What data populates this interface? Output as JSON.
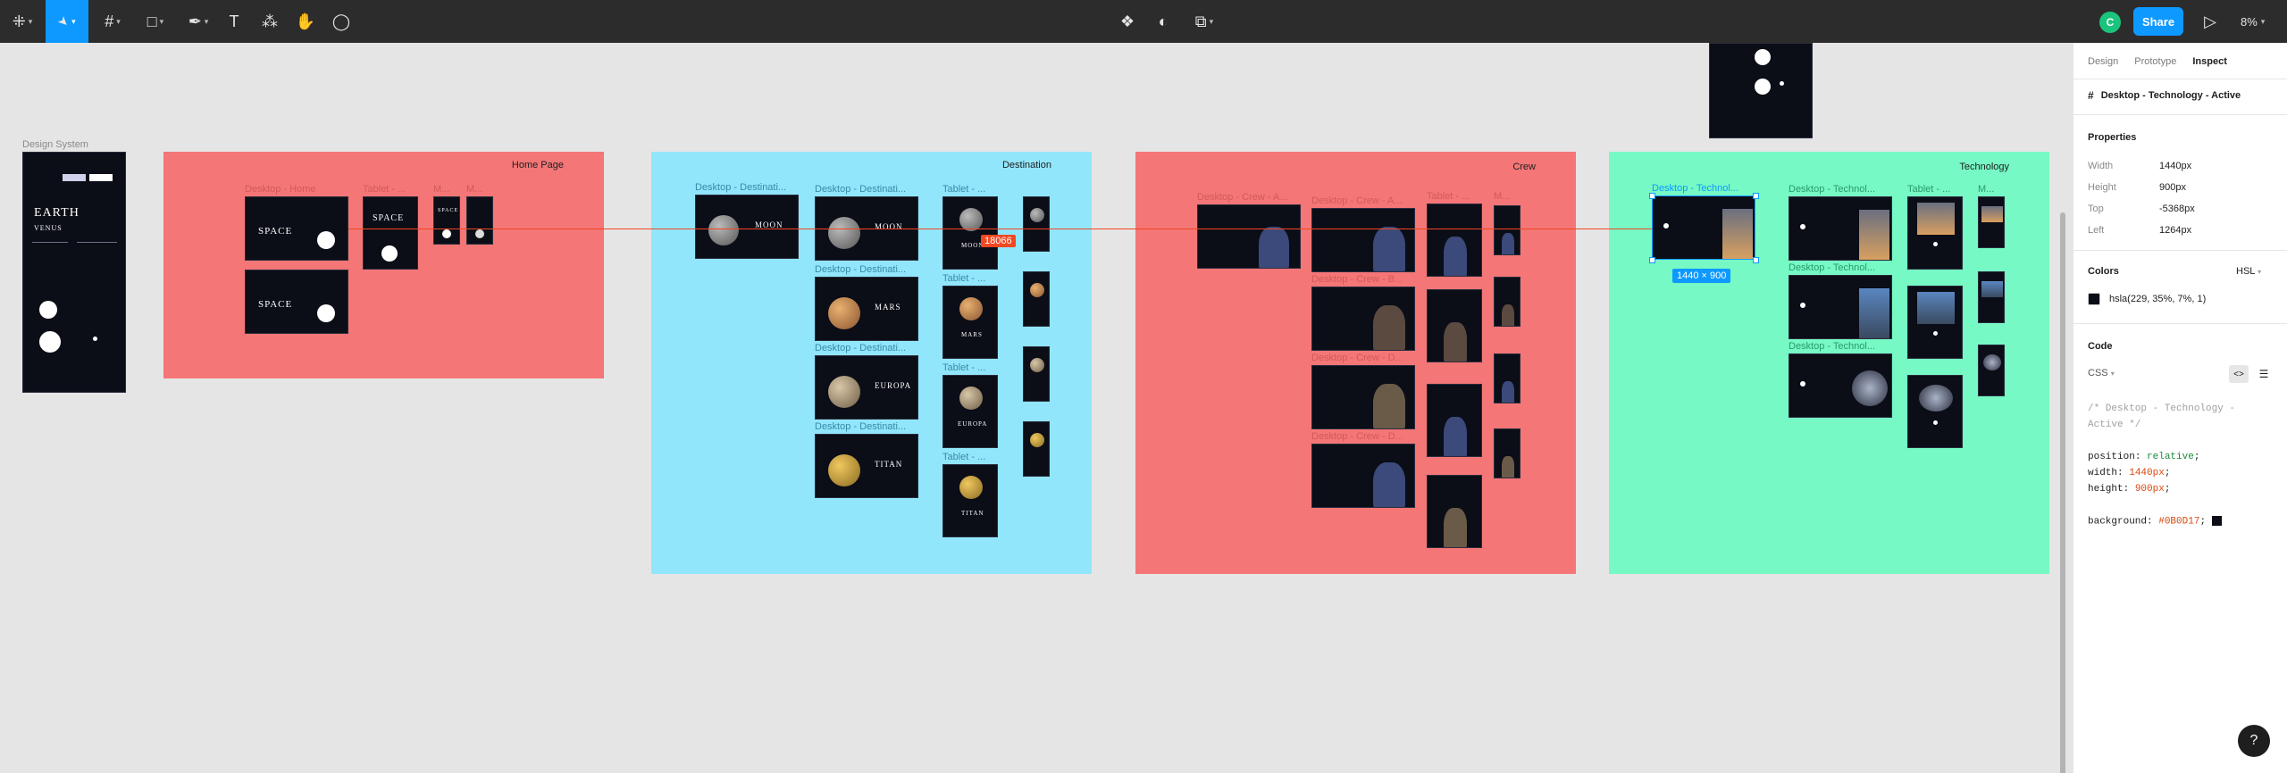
{
  "toolbar": {
    "tools": [
      {
        "name": "main-menu-button",
        "icon": "figma-logo-icon",
        "glyph": "⁜",
        "caret": true,
        "active": false
      },
      {
        "name": "move-tool-button",
        "icon": "cursor-icon",
        "glyph": "➤",
        "caret": true,
        "active": true
      },
      {
        "name": "frame-tool-button",
        "icon": "hash-icon",
        "glyph": "#",
        "caret": true,
        "active": false
      },
      {
        "name": "shape-tool-button",
        "icon": "rectangle-icon",
        "glyph": "□",
        "caret": true,
        "active": false
      },
      {
        "name": "pen-tool-button",
        "icon": "pen-icon",
        "glyph": "✒",
        "caret": true,
        "active": false
      },
      {
        "name": "text-tool-button",
        "icon": "text-icon",
        "glyph": "T",
        "caret": false,
        "active": false
      },
      {
        "name": "resources-button",
        "icon": "components-icon",
        "glyph": "⁂",
        "caret": false,
        "active": false
      },
      {
        "name": "hand-tool-button",
        "icon": "hand-icon",
        "glyph": "✋",
        "caret": false,
        "active": false
      },
      {
        "name": "comment-tool-button",
        "icon": "comment-icon",
        "glyph": "◯",
        "caret": false,
        "active": false
      }
    ],
    "center_tools": [
      {
        "name": "component-button",
        "icon": "component-icon",
        "glyph": "❖"
      },
      {
        "name": "mask-button",
        "icon": "contrast-icon",
        "glyph": "◐"
      },
      {
        "name": "boolean-button",
        "icon": "boolean-icon",
        "glyph": "⧉"
      }
    ],
    "avatar_initial": "C",
    "share_label": "Share",
    "play_glyph": "▷",
    "zoom_label": "8%"
  },
  "canvas": {
    "design_system_label": "Design System",
    "sections": [
      {
        "title": "Home Page",
        "color": "#f47676"
      },
      {
        "title": "Destination",
        "color": "#92e6fb"
      },
      {
        "title": "Crew",
        "color": "#f47676"
      },
      {
        "title": "Technology",
        "color": "#76f9c4"
      }
    ],
    "frame_labels": {
      "home_desktop": "Desktop - Home",
      "home_tablet": "Tablet - ...",
      "home_m1": "M...",
      "home_m2": "M...",
      "dest_desktop_1": "Desktop - Destinati...",
      "dest_desktop_2": "Desktop - Destinati...",
      "dest_desktop_3": "Desktop - Destinati...",
      "dest_desktop_4": "Desktop - Destinati...",
      "dest_desktop_5": "Desktop - Destinati...",
      "dest_tablet_1": "Tablet - ...",
      "dest_tablet_2": "Tablet - ...",
      "dest_tablet_3": "Tablet - ...",
      "dest_tablet_4": "Tablet - ...",
      "dest_m": "M...",
      "crew_desktop_1": "Desktop - Crew - A...",
      "crew_desktop_2": "Desktop - Crew - A...",
      "crew_desktop_3": "Desktop - Crew - B...",
      "crew_desktop_4": "Desktop - Crew - D...",
      "crew_desktop_5": "Desktop - Crew - D...",
      "crew_tablet": "Tablet - ...",
      "crew_m": "M...",
      "tech_desktop_1": "Desktop - Technol...",
      "tech_desktop_2": "Desktop - Technol...",
      "tech_desktop_3": "Desktop - Technol...",
      "tech_desktop_4": "Desktop - Technol...",
      "tech_tablet": "Tablet - ...",
      "tech_m": "M..."
    },
    "frame_text": {
      "space": "SPACE",
      "moon": "MOON",
      "mars": "MARS",
      "europa": "EUROPA",
      "titan": "TITAN",
      "earth": "EARTH",
      "venus": "VENUS"
    },
    "distance_tag": "18066",
    "selection_size": "1440 × 900"
  },
  "panel": {
    "tabs": [
      "Design",
      "Prototype",
      "Inspect"
    ],
    "active_tab": "Inspect",
    "layer_icon": "frame-icon",
    "layer_name": "Desktop - Technology - Active",
    "properties_title": "Properties",
    "properties": [
      {
        "key": "Width",
        "value": "1440px"
      },
      {
        "key": "Height",
        "value": "900px"
      },
      {
        "key": "Top",
        "value": "-5368px"
      },
      {
        "key": "Left",
        "value": "1264px"
      }
    ],
    "colors_title": "Colors",
    "color_mode": "HSL",
    "color_value": "hsla(229, 35%, 7%, 1)",
    "color_hex": "#0b0d17",
    "code_title": "Code",
    "code_lang": "CSS",
    "code_comment_1": "/* Desktop - Technology -",
    "code_comment_2": "Active */",
    "code_lines": [
      {
        "prop": "position",
        "value": "relative",
        "kind": "g"
      },
      {
        "prop": "width",
        "value": "1440px",
        "kind": "o"
      },
      {
        "prop": "height",
        "value": "900px",
        "kind": "o"
      }
    ],
    "background_prop": "background",
    "background_value": "#0B0D17",
    "help_glyph": "?"
  }
}
